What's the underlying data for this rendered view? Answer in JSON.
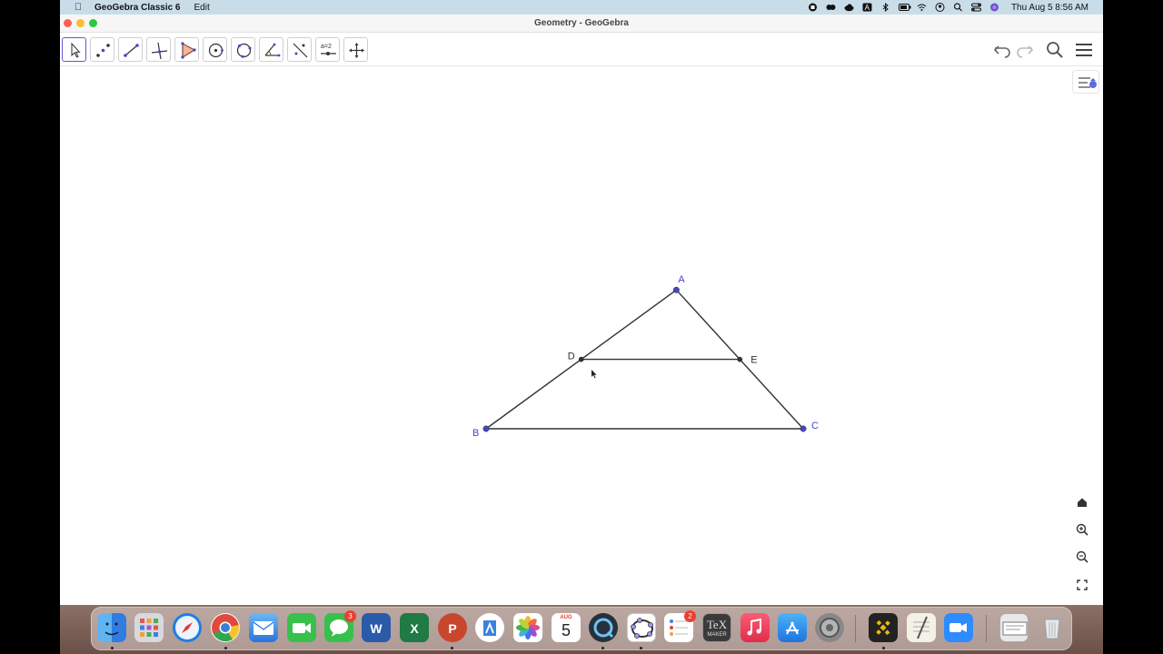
{
  "menubar": {
    "app_name": "GeoGebra Classic 6",
    "menus": [
      "Edit"
    ],
    "clock": "Thu Aug 5  8:56 AM"
  },
  "window": {
    "title": "Geometry - GeoGebra"
  },
  "toolbar": {
    "tools": [
      "move-tool",
      "point-tool",
      "segment-tool",
      "perpendicular-line-tool",
      "polygon-tool",
      "circle-tool",
      "circle-three-points-tool",
      "angle-tool",
      "reflect-tool",
      "slider-tool",
      "move-graphics-view-tool"
    ],
    "slider_tool_label": "a=2",
    "right_tools": [
      "undo-icon",
      "redo-icon",
      "search-icon",
      "menu-icon"
    ]
  },
  "construction": {
    "points": [
      {
        "name": "A",
        "x": 3.0,
        "y": 4.0,
        "color": "#4646c8"
      },
      {
        "name": "B",
        "x": 0.0,
        "y": 0.0,
        "color": "#4646c8"
      },
      {
        "name": "C",
        "x": 5.0,
        "y": 0.0,
        "color": "#4646c8"
      },
      {
        "name": "D",
        "x": 1.5,
        "y": 2.0,
        "color": "#333333"
      },
      {
        "name": "E",
        "x": 4.0,
        "y": 2.0,
        "color": "#333333"
      }
    ],
    "segments": [
      [
        "A",
        "B"
      ],
      [
        "A",
        "C"
      ],
      [
        "B",
        "C"
      ],
      [
        "D",
        "E"
      ]
    ]
  },
  "graphics_controls": [
    "home-icon",
    "zoom-in-icon",
    "zoom-out-icon",
    "fullscreen-icon"
  ],
  "dock": {
    "calendar_month": "AUG",
    "calendar_day": "5",
    "messages_badge": "3",
    "reminders_badge": "2",
    "word_letter": "W",
    "excel_letter": "X",
    "powerpoint_letter": "P",
    "texmaker_label": "TeX",
    "texmaker_sub": "MAKER"
  }
}
